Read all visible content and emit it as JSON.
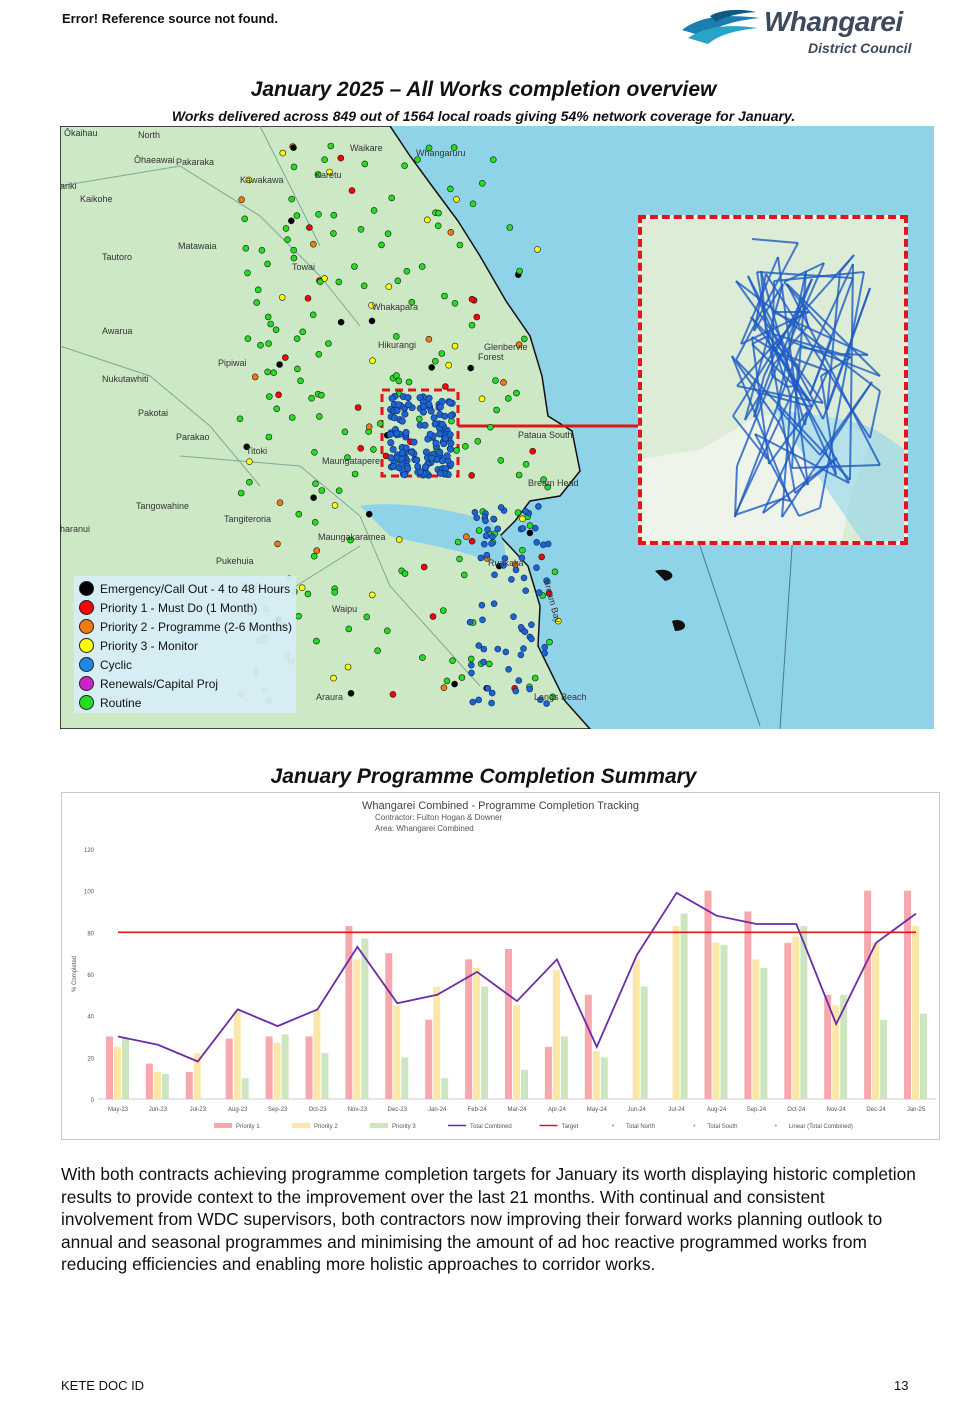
{
  "header": {
    "ref_text": "Error! Reference source not found.",
    "logo_word": "Whangarei",
    "logo_sub": "District Council"
  },
  "map": {
    "title": "January 2025 – All Works completion overview",
    "subtitle": "Works delivered across 849 out of 1564 local roads giving 54% network coverage for January.",
    "places": [
      "Ōkaihau",
      "North",
      "Ōhaeawai",
      "Pakaraka",
      "Kawakawa",
      "Karetu",
      "Waikare",
      "Whangaruru",
      "ariki",
      "Kaikohe",
      "Matawaia",
      "Tautoro",
      "Towai",
      "Whakapara",
      "Awarua",
      "Hikurangi",
      "Glenbervie",
      "Forest",
      "Pipiwai",
      "Nukutawhiti",
      "Pakotai",
      "Parakao",
      "Titoki",
      "Maungatapere",
      "Tangowahine",
      "Tangiteroria",
      "haranui",
      "Pukehuia",
      "Maungakaramea",
      "Waipu",
      "Ruakaka",
      "Pataua South",
      "Bream Bay",
      "Langs Beach",
      "Araura",
      "Bream Head"
    ],
    "legend": [
      {
        "label": "Emergency/Call Out - 4 to 48 Hours",
        "color": "#000000"
      },
      {
        "label": "Priority 1 - Must Do (1 Month)",
        "color": "#ff0000"
      },
      {
        "label": "Priority 2 - Programme (2-6 Months)",
        "color": "#f07b10"
      },
      {
        "label": "Priority 3 - Monitor",
        "color": "#ffff00"
      },
      {
        "label": "Cyclic",
        "color": "#1e88e5"
      },
      {
        "label": "Renewals/Capital Proj",
        "color": "#cc22cc"
      },
      {
        "label": "Routine",
        "color": "#22dd22"
      }
    ]
  },
  "chart_section_title": "January Programme Completion Summary",
  "chart_data": {
    "type": "bar",
    "title": "Whangarei Combined - Programme Completion Tracking",
    "subtitle_lines": [
      "Contractor: Fulton Hogan & Downer",
      "Area: Whangarei Combined"
    ],
    "ylabel": "% Completed",
    "ylim": [
      0,
      120
    ],
    "yticks": [
      0,
      20,
      40,
      60,
      80,
      100,
      120
    ],
    "categories": [
      "May-23",
      "Jun-23",
      "Jul-23",
      "Aug-23",
      "Sep-23",
      "Oct-23",
      "Nov-23",
      "Dec-23",
      "Jan-24",
      "Feb-24",
      "Mar-24",
      "Apr-24",
      "May-24",
      "Jun-24",
      "Jul-24",
      "Aug-24",
      "Sep-24",
      "Oct-24",
      "Nov-24",
      "Dec-24",
      "Jan-25"
    ],
    "series": [
      {
        "name": "Priority 1",
        "color": "#f7a8ac",
        "values": [
          30,
          17,
          13,
          29,
          30,
          30,
          83,
          70,
          38,
          67,
          72,
          25,
          50,
          0,
          0,
          100,
          90,
          75,
          50,
          100,
          100
        ]
      },
      {
        "name": "Priority 2",
        "color": "#fde7a8",
        "values": [
          25,
          13,
          22,
          42,
          27,
          43,
          67,
          45,
          54,
          63,
          45,
          62,
          23,
          67,
          83,
          75,
          67,
          78,
          45,
          75,
          83
        ]
      },
      {
        "name": "Priority 3",
        "color": "#cde6c0",
        "values": [
          29,
          12,
          0,
          10,
          31,
          22,
          77,
          20,
          10,
          54,
          14,
          30,
          20,
          54,
          89,
          74,
          63,
          83,
          50,
          38,
          41
        ]
      }
    ],
    "line_series": [
      {
        "name": "Total Combined",
        "color": "#6a2ca8",
        "values": [
          30,
          26,
          18,
          43,
          35,
          43,
          73,
          46,
          50,
          61,
          47,
          67,
          25,
          69,
          99,
          88,
          84,
          84,
          36,
          75,
          89
        ]
      },
      {
        "name": "Target",
        "color": "#e0161c",
        "values": [
          80,
          80,
          80,
          80,
          80,
          80,
          80,
          80,
          80,
          80,
          80,
          80,
          80,
          80,
          80,
          80,
          80,
          80,
          80,
          80,
          80
        ]
      }
    ],
    "legend_extra": [
      "Total North",
      "Total South",
      "Linear (Total Combined)"
    ]
  },
  "body_text": "With both contracts achieving programme completion targets for January its worth displaying historic completion results to provide context to the improvement over the last 21 months. With continual and consistent involvement from WDC supervisors, both contractors now improving their forward works planning outlook to annual and seasonal programmes and minimising the amount of ad hoc reactive programmed works from reducing efficiencies and enabling more holistic approaches to corridor works.",
  "footer": {
    "doc_id": "KETE DOC ID",
    "page_number": "13"
  }
}
